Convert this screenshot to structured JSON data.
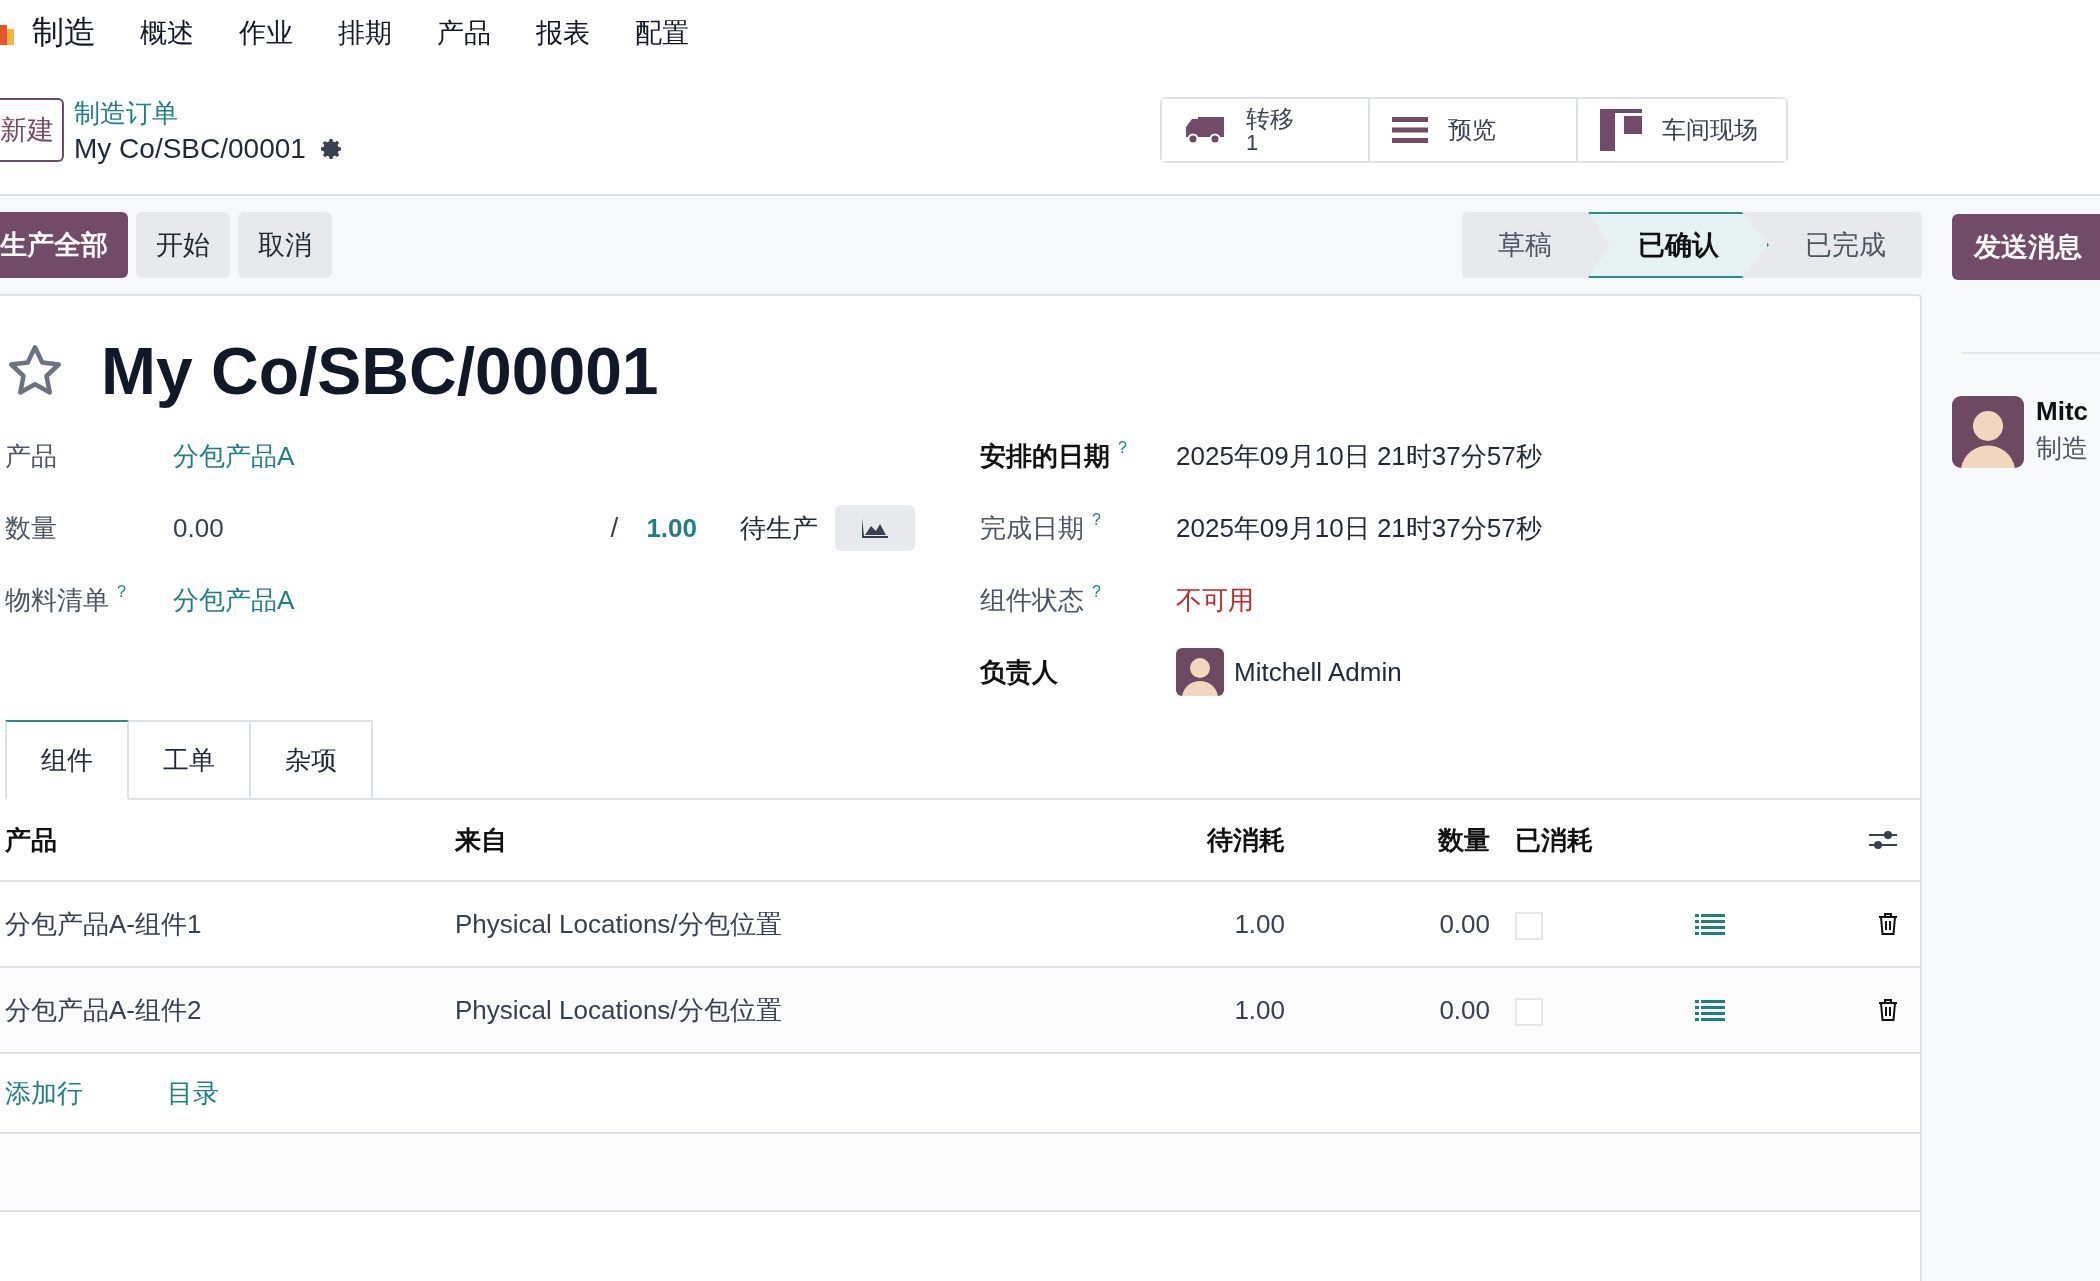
{
  "app": {
    "name": "制造",
    "menu": [
      "概述",
      "作业",
      "排期",
      "产品",
      "报表",
      "配置"
    ]
  },
  "breadcrumb": {
    "new_button": "新建",
    "parent": "制造订单",
    "current": "My Co/SBC/00001"
  },
  "smart_buttons": [
    {
      "kind": "transfer",
      "label": "转移",
      "count": "1"
    },
    {
      "kind": "preview",
      "label": "预览"
    },
    {
      "kind": "shopfloor",
      "label": "车间现场"
    }
  ],
  "actions": [
    {
      "label": "生产全部",
      "primary": true
    },
    {
      "label": "开始",
      "primary": false
    },
    {
      "label": "取消",
      "primary": false
    }
  ],
  "status": [
    {
      "label": "草稿",
      "selected": false
    },
    {
      "label": "已确认",
      "selected": true
    },
    {
      "label": "已完成",
      "selected": false
    }
  ],
  "send_message": "发送消息",
  "record": {
    "starred": false,
    "title": "My Co/SBC/00001"
  },
  "left_fields": [
    {
      "kind": "link",
      "label": "产品",
      "value": "分包产品A"
    },
    {
      "kind": "quantity",
      "label": "数量",
      "value": "0.00",
      "separator": "/",
      "target": "1.00",
      "unit": "待生产"
    },
    {
      "kind": "link",
      "label": "物料清单",
      "help": "?",
      "value": "分包产品A"
    }
  ],
  "right_fields": [
    {
      "kind": "text",
      "label": "安排的日期",
      "help": "?",
      "bold": true,
      "value": "2025年09月10日 21时37分57秒"
    },
    {
      "kind": "text",
      "label": "完成日期",
      "help": "?",
      "bold": false,
      "value": "2025年09月10日 21时37分57秒"
    },
    {
      "kind": "alert",
      "label": "组件状态",
      "help": "?",
      "bold": false,
      "value": "不可用"
    },
    {
      "kind": "user",
      "label": "负责人",
      "bold": true,
      "value": "Mitchell Admin"
    }
  ],
  "tabs": [
    {
      "label": "组件",
      "selected": true
    },
    {
      "label": "工单",
      "selected": false
    },
    {
      "label": "杂项",
      "selected": false
    }
  ],
  "table": {
    "columns": [
      "产品",
      "来自",
      "待消耗",
      "数量",
      "已消耗"
    ],
    "rows": [
      {
        "product": "分包产品A-组件1",
        "from": "Physical Locations/分包位置",
        "to_consume": "1.00",
        "quantity": "0.00",
        "consumed": false
      },
      {
        "product": "分包产品A-组件2",
        "from": "Physical Locations/分包位置",
        "to_consume": "1.00",
        "quantity": "0.00",
        "consumed": false
      }
    ],
    "add_line": "添加行",
    "catalog": "目录"
  },
  "chatter": {
    "author": "Mitc",
    "subtitle": "制造"
  }
}
